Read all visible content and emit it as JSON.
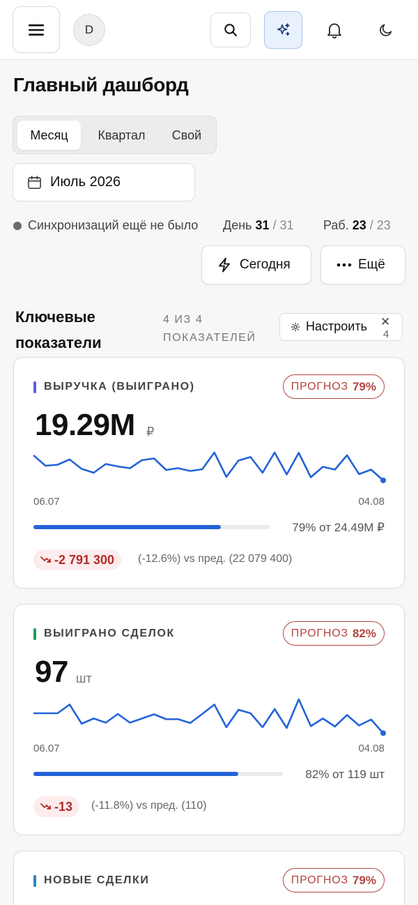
{
  "header": {
    "avatar_initial": "D",
    "icons": [
      "menu-icon",
      "search-icon",
      "sparkles-icon",
      "bell-icon",
      "moon-icon"
    ]
  },
  "page": {
    "title": "Главный дашборд",
    "periods": [
      "Месяц",
      "Квартал",
      "Свой"
    ],
    "active_period": "Месяц",
    "date_value": "Июль 2026"
  },
  "status": {
    "sync_text": "Синхронизаций ещё не было",
    "day_label": "День",
    "day_current": "31",
    "day_total": "/ 31",
    "separator": "·",
    "work_label": "Раб.",
    "work_current": "23",
    "work_total": "/ 23"
  },
  "actions": {
    "today_label": "Сегодня",
    "more_label": "Ещё"
  },
  "section": {
    "title": "Ключевые показатели",
    "count": "4 ИЗ 4 ПОКАЗАТЕЛЕЙ",
    "configure_label": "Настроить",
    "configure_x": "✕",
    "configure_count": "4"
  },
  "cards": [
    {
      "title": "ВЫРУЧКА (ВЫИГРАНО)",
      "accent": "#5b5fe8",
      "forecast_label": "ПРОГНОЗ",
      "forecast_value": "79%",
      "value": "19.29M",
      "unit": "₽",
      "date_start": "06.07",
      "date_end": "04.08",
      "progress": 0.79,
      "progress_text": "79% от 24.49M ₽",
      "delta": "-2 791 300",
      "delta_note": "(-12.6%)  vs пред. (22 079 400)",
      "spark": [
        0.92,
        0.62,
        0.65,
        0.8,
        0.53,
        0.42,
        0.67,
        0.6,
        0.55,
        0.78,
        0.83,
        0.5,
        0.55,
        0.47,
        0.52,
        1.0,
        0.3,
        0.77,
        0.87,
        0.42,
        1.0,
        0.37,
        0.99,
        0.29,
        0.59,
        0.51,
        0.92,
        0.38,
        0.51,
        0.2
      ]
    },
    {
      "title": "ВЫИГРАНО СДЕЛОК",
      "accent": "#1f9d5a",
      "forecast_label": "ПРОГНОЗ",
      "forecast_value": "82%",
      "value": "97",
      "unit": "шт",
      "date_start": "06.07",
      "date_end": "04.08",
      "progress": 0.82,
      "progress_text": "82% от 119 шт",
      "delta": "-13",
      "delta_note": "(-11.8%)  vs пред. (110)",
      "spark": [
        0.6,
        0.6,
        0.6,
        0.85,
        0.3,
        0.45,
        0.33,
        0.58,
        0.33,
        0.45,
        0.57,
        0.43,
        0.43,
        0.32,
        0.58,
        0.85,
        0.2,
        0.7,
        0.6,
        0.2,
        0.72,
        0.18,
        1.0,
        0.23,
        0.45,
        0.22,
        0.55,
        0.25,
        0.42,
        0.03
      ]
    },
    {
      "title": "НОВЫЕ СДЕЛКИ",
      "accent": "#2a85c8",
      "forecast_label": "ПРОГНОЗ",
      "forecast_value": "79%"
    }
  ]
}
